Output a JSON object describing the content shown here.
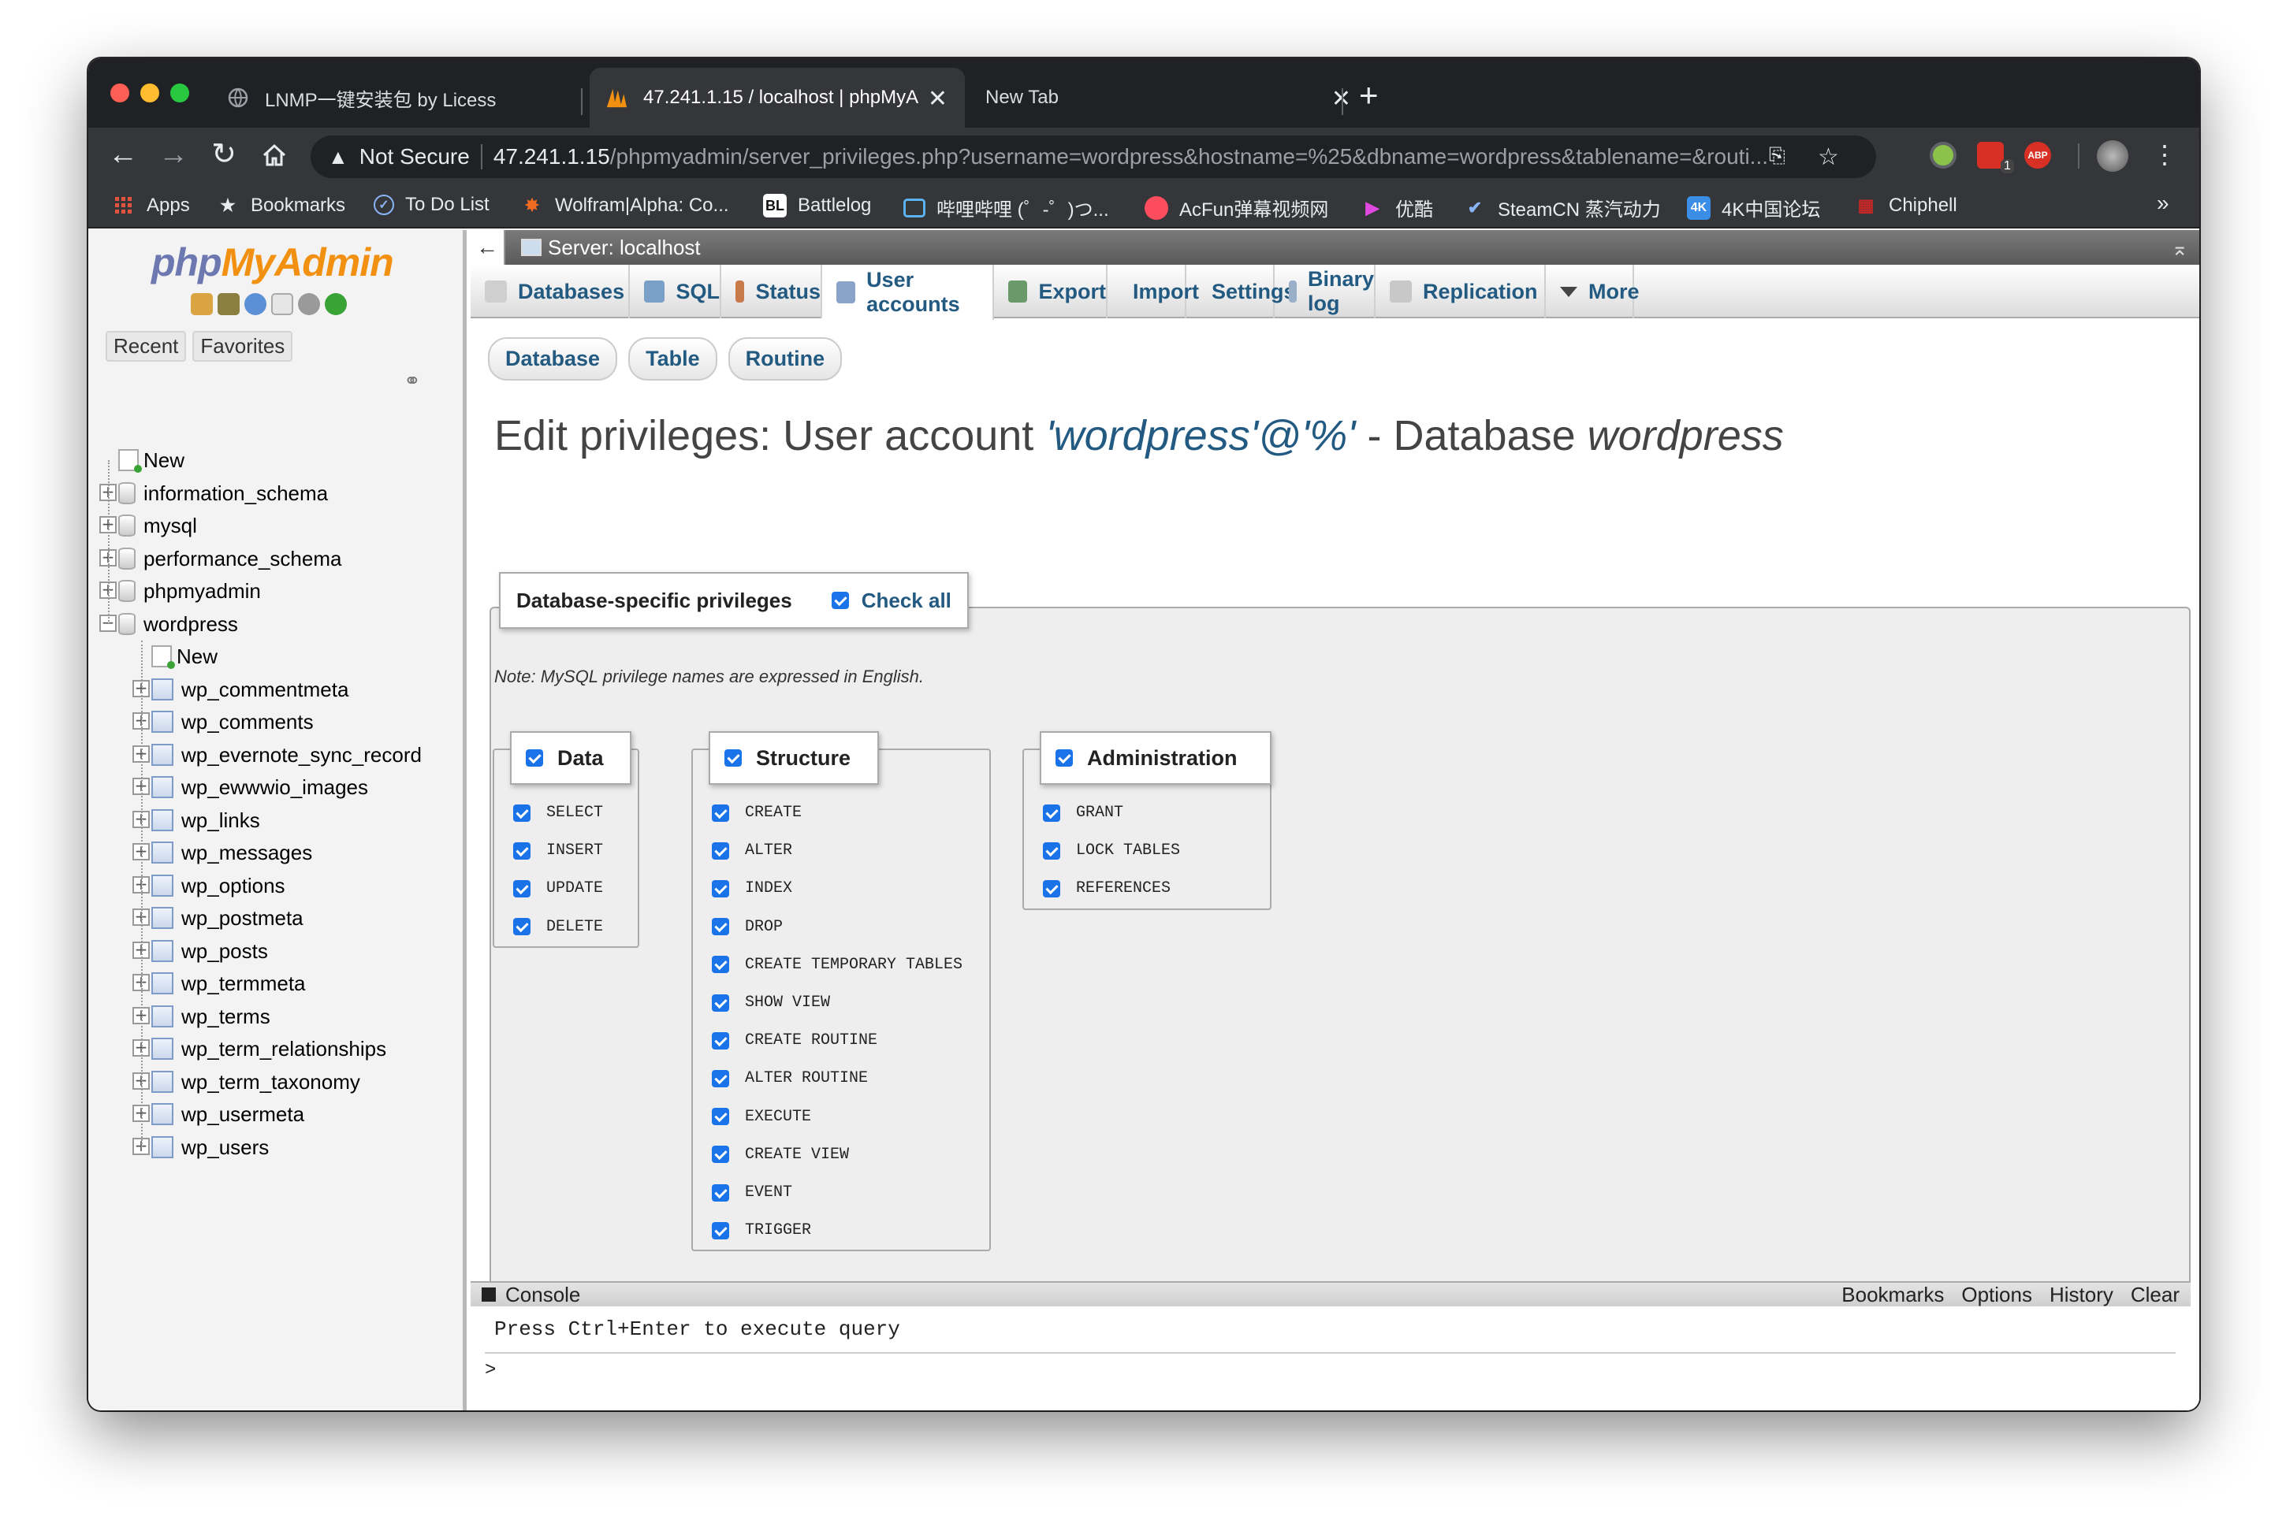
{
  "browser": {
    "tabs": [
      {
        "title": "LNMP一键安装包 by Licess",
        "active": false
      },
      {
        "title": "47.241.1.15 / localhost | phpMyA",
        "active": true
      },
      {
        "title": "New Tab",
        "active": false
      }
    ],
    "security_label": "Not Secure",
    "url_host": "47.241.1.15",
    "url_path": "/phpmyadmin/server_privileges.php?username=wordpress&hostname=%25&dbname=wordpress&tablename=&routi...",
    "extension_badge": "1",
    "abp_label": "ABP"
  },
  "bookmarks": [
    {
      "label": "Apps",
      "icon": "apps-grid-icon"
    },
    {
      "label": "Bookmarks",
      "icon": "star-icon"
    },
    {
      "label": "To Do List",
      "icon": "check-circle-icon"
    },
    {
      "label": "Wolfram|Alpha: Co...",
      "icon": "wolfram-icon"
    },
    {
      "label": "Battlelog",
      "icon": "battlelog-icon"
    },
    {
      "label": "哔哩哔哩 (゜-゜)つ...",
      "icon": "bilibili-icon"
    },
    {
      "label": "AcFun弹幕视频网",
      "icon": "acfun-icon"
    },
    {
      "label": "优酷",
      "icon": "youku-icon"
    },
    {
      "label": "SteamCN 蒸汽动力",
      "icon": "steamcn-icon"
    },
    {
      "label": "4K中国论坛",
      "icon": "4k-icon"
    },
    {
      "label": "Chiphell",
      "icon": "chiphell-icon"
    }
  ],
  "bookmarks_overflow": "»",
  "sidebar": {
    "logo_php": "php",
    "logo_myadmin": "MyAdmin",
    "tabs": [
      "Recent",
      "Favorites"
    ],
    "tree": [
      {
        "label": "New",
        "type": "new",
        "level": 0
      },
      {
        "label": "information_schema",
        "type": "db",
        "level": 0
      },
      {
        "label": "mysql",
        "type": "db",
        "level": 0
      },
      {
        "label": "performance_schema",
        "type": "db",
        "level": 0
      },
      {
        "label": "phpmyadmin",
        "type": "db",
        "level": 0
      },
      {
        "label": "wordpress",
        "type": "db-open",
        "level": 0
      },
      {
        "label": "New",
        "type": "new",
        "level": 1
      },
      {
        "label": "wp_commentmeta",
        "type": "table",
        "level": 1
      },
      {
        "label": "wp_comments",
        "type": "table",
        "level": 1
      },
      {
        "label": "wp_evernote_sync_record",
        "type": "table",
        "level": 1
      },
      {
        "label": "wp_ewwwio_images",
        "type": "table",
        "level": 1
      },
      {
        "label": "wp_links",
        "type": "table",
        "level": 1
      },
      {
        "label": "wp_messages",
        "type": "table",
        "level": 1
      },
      {
        "label": "wp_options",
        "type": "table",
        "level": 1
      },
      {
        "label": "wp_postmeta",
        "type": "table",
        "level": 1
      },
      {
        "label": "wp_posts",
        "type": "table",
        "level": 1
      },
      {
        "label": "wp_termmeta",
        "type": "table",
        "level": 1
      },
      {
        "label": "wp_terms",
        "type": "table",
        "level": 1
      },
      {
        "label": "wp_term_relationships",
        "type": "table",
        "level": 1
      },
      {
        "label": "wp_term_taxonomy",
        "type": "table",
        "level": 1
      },
      {
        "label": "wp_usermeta",
        "type": "table",
        "level": 1
      },
      {
        "label": "wp_users",
        "type": "table",
        "level": 1
      }
    ]
  },
  "server_bar": {
    "label": "Server: localhost"
  },
  "main_tabs": [
    {
      "label": "Databases",
      "active": false
    },
    {
      "label": "SQL",
      "active": false
    },
    {
      "label": "Status",
      "active": false
    },
    {
      "label": "User accounts",
      "active": true
    },
    {
      "label": "Export",
      "active": false
    },
    {
      "label": "Import",
      "active": false
    },
    {
      "label": "Settings",
      "active": false
    },
    {
      "label": "Binary log",
      "active": false
    },
    {
      "label": "Replication",
      "active": false
    },
    {
      "label": "More",
      "active": false
    }
  ],
  "sub_tabs": [
    "Database",
    "Table",
    "Routine"
  ],
  "title": {
    "prefix": "Edit privileges: User account ",
    "user": "'wordpress'@'%'",
    "middle": " - Database ",
    "db": "wordpress"
  },
  "privileges": {
    "legend": "Database-specific privileges",
    "check_all": "Check all",
    "note": "Note: MySQL privilege names are expressed in English.",
    "groups": [
      {
        "name": "Data",
        "items": [
          "SELECT",
          "INSERT",
          "UPDATE",
          "DELETE"
        ]
      },
      {
        "name": "Structure",
        "items": [
          "CREATE",
          "ALTER",
          "INDEX",
          "DROP",
          "CREATE TEMPORARY TABLES",
          "SHOW VIEW",
          "CREATE ROUTINE",
          "ALTER ROUTINE",
          "EXECUTE",
          "CREATE VIEW",
          "EVENT",
          "TRIGGER"
        ]
      },
      {
        "name": "Administration",
        "items": [
          "GRANT",
          "LOCK TABLES",
          "REFERENCES"
        ]
      }
    ]
  },
  "console": {
    "label": "Console",
    "links": [
      "Bookmarks",
      "Options",
      "History",
      "Clear"
    ],
    "hint": "Press Ctrl+Enter to execute query",
    "prompt": ">"
  }
}
